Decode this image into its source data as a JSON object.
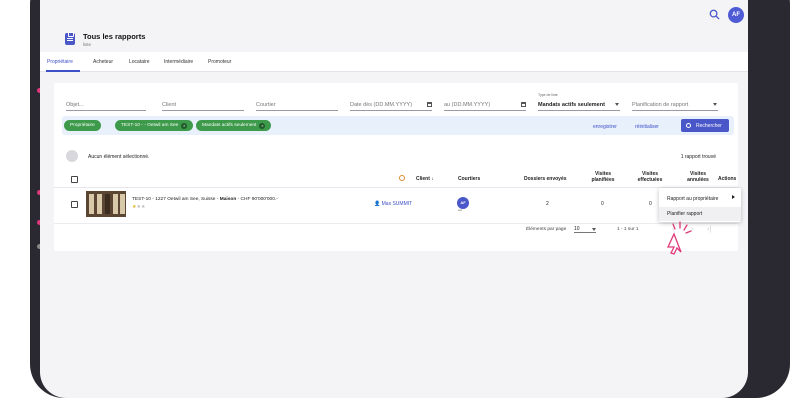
{
  "header": {
    "avatar_initials": "AF",
    "icons": {
      "search": "search-icon",
      "report": "clipboard-icon"
    }
  },
  "page": {
    "title": "Tous les rapports",
    "subtitle": "liste"
  },
  "tabs": [
    {
      "label": "Propriétaire",
      "active": true
    },
    {
      "label": "Acheteur"
    },
    {
      "label": "Locataire"
    },
    {
      "label": "Intermédiaire"
    },
    {
      "label": "Promoteur"
    }
  ],
  "filters": {
    "objet_placeholder": "Objet...",
    "client_placeholder": "Client",
    "courtier_placeholder": "Courtier",
    "date_from_placeholder": "Date dès (DD.MM.YYYY)",
    "date_to_placeholder": "au (DD.MM.YYYY)",
    "type_label": "Type de liste",
    "type_value": "Mandats actifs seulement",
    "planning_placeholder": "Planification de rapport"
  },
  "chips": [
    {
      "label": "Propriétaire",
      "removable": false
    },
    {
      "label": "TEST-10 - - Oetwil am See",
      "removable": true
    },
    {
      "label": "Mandats actifs seulement",
      "removable": true
    }
  ],
  "actions": {
    "save": "enregistrer",
    "reset": "réinitialiser",
    "search": "Rechercher"
  },
  "selection": {
    "text": "Aucun élément sélectionné.",
    "found": "1 rapport trouvé"
  },
  "table": {
    "headers": {
      "client": "Client",
      "courtiers": "Courtiers",
      "dossiers": "Dossiers envoyés",
      "visites_planifiees": "Visites planifiées",
      "visites_effectuees": "Visites effectuées",
      "visites_annulees": "Visites annulées",
      "actions": "Actions"
    },
    "rows": [
      {
        "ref": "TEST-10",
        "address": " - 1227 Oetwil am See, Suisse - ",
        "type": "Maison",
        "price": " - CHF 90'000'000.-",
        "rating": 1,
        "rating_max": 3,
        "client": "Max SUMMIT",
        "courtier_initials": "AF",
        "courtier_sub": "test",
        "dossiers": "2",
        "visites_planifiees": "0",
        "visites_effectuees": "0"
      }
    ]
  },
  "pagination": {
    "per_page_label": "Éléments par page",
    "per_page_value": "10",
    "range": "1 - 1 sur 1"
  },
  "context_menu": [
    {
      "label": "Rapport au propriétaire",
      "has_submenu": true
    },
    {
      "label": "Planifier rapport",
      "highlighted": true
    }
  ],
  "colors": {
    "primary": "#4a57c9",
    "chip_green": "#3c9a4a",
    "accent_pink": "#e0387a"
  }
}
